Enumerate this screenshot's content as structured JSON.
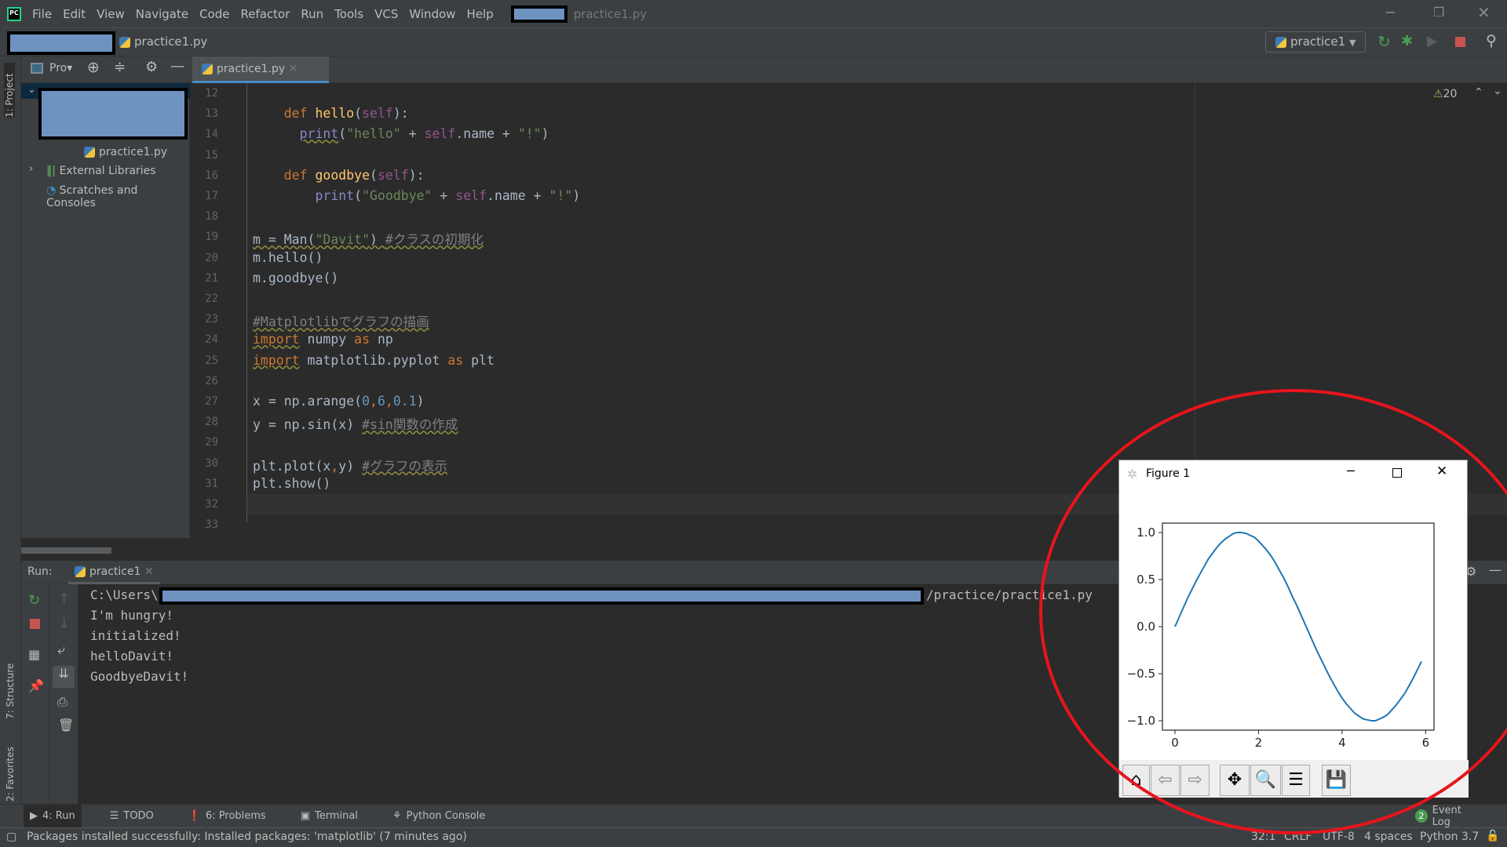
{
  "menubar": {
    "items": [
      "File",
      "Edit",
      "View",
      "Navigate",
      "Code",
      "Refactor",
      "Run",
      "Tools",
      "VCS",
      "Window",
      "Help"
    ],
    "file_title": "practice1.py"
  },
  "navbar": {
    "file": "practice1.py",
    "run_config": "practice1"
  },
  "project": {
    "panel_label": "Pro▾",
    "stripe_label": "1: Project",
    "items": [
      {
        "label": "practice1.py"
      },
      {
        "label": "External Libraries"
      },
      {
        "label": "Scratches and Consoles"
      }
    ]
  },
  "editor": {
    "tab": "practice1.py",
    "warnings": "20",
    "line_numbers": [
      "12",
      "13",
      "14",
      "15",
      "16",
      "17",
      "18",
      "19",
      "20",
      "21",
      "22",
      "23",
      "24",
      "25",
      "26",
      "27",
      "28",
      "29",
      "30",
      "31",
      "32",
      "33"
    ],
    "lines": [
      [],
      [
        [
          "    ",
          ""
        ],
        [
          "def",
          "kw"
        ],
        [
          " ",
          ""
        ],
        [
          "hello",
          "fn"
        ],
        [
          "(",
          ""
        ],
        [
          "self",
          "sf"
        ],
        [
          "):",
          ""
        ]
      ],
      [
        [
          "      ",
          ""
        ],
        [
          "print",
          "bi wavy"
        ],
        [
          "(",
          ""
        ],
        [
          "\"hello\"",
          "st"
        ],
        [
          " + ",
          ""
        ],
        [
          "self",
          "sf"
        ],
        [
          ".name + ",
          ""
        ],
        [
          "\"!\"",
          "st"
        ],
        [
          ")",
          ""
        ]
      ],
      [],
      [
        [
          "    ",
          ""
        ],
        [
          "def",
          "kw"
        ],
        [
          " ",
          ""
        ],
        [
          "goodbye",
          "fn"
        ],
        [
          "(",
          ""
        ],
        [
          "self",
          "sf"
        ],
        [
          "):",
          ""
        ]
      ],
      [
        [
          "        ",
          ""
        ],
        [
          "print",
          "bi"
        ],
        [
          "(",
          ""
        ],
        [
          "\"Goodbye\"",
          "st"
        ],
        [
          " + ",
          ""
        ],
        [
          "self",
          "sf"
        ],
        [
          ".name + ",
          ""
        ],
        [
          "\"!\"",
          "st"
        ],
        [
          ")",
          ""
        ]
      ],
      [],
      [
        [
          "m = Man(",
          "wavy"
        ],
        [
          "\"Davit\"",
          "st wavy"
        ],
        [
          ") ",
          "wavy"
        ],
        [
          "#クラスの初期化",
          "cm wavy"
        ]
      ],
      [
        [
          "m.hello()",
          ""
        ]
      ],
      [
        [
          "m.goodbye()",
          ""
        ]
      ],
      [],
      [
        [
          "#Matplotlibでグラフの描画",
          "cm wavy"
        ]
      ],
      [
        [
          "import",
          "kw wavy"
        ],
        [
          " numpy ",
          ""
        ],
        [
          "as",
          "kw"
        ],
        [
          " np",
          ""
        ]
      ],
      [
        [
          "import",
          "kw wavy"
        ],
        [
          " matplotlib.pyplot ",
          ""
        ],
        [
          "as",
          "kw"
        ],
        [
          " plt",
          ""
        ]
      ],
      [],
      [
        [
          "x = np.arange(",
          ""
        ],
        [
          "0",
          "nu"
        ],
        [
          ",",
          "kw"
        ],
        [
          "6",
          "nu"
        ],
        [
          ",",
          "kw"
        ],
        [
          "0.1",
          "nu"
        ],
        [
          ")",
          ""
        ]
      ],
      [
        [
          "y = np.sin(x) ",
          ""
        ],
        [
          "#sin関数の作成",
          "cm wavy"
        ]
      ],
      [],
      [
        [
          "plt.plot(x",
          ""
        ],
        [
          ",",
          "kw"
        ],
        [
          "y) ",
          ""
        ],
        [
          "#グラフの表示",
          "cm wavy"
        ]
      ],
      [
        [
          "plt.show()",
          ""
        ]
      ],
      [],
      []
    ]
  },
  "run": {
    "label": "Run:",
    "tab": "practice1",
    "output": [
      "C:\\Users\\",
      "I'm hungry!",
      "initialized!",
      "helloDavit!",
      "GoodbyeDavit!"
    ],
    "path_suffix": "/practice/practice1.py"
  },
  "left_stripe": {
    "structure": "7: Structure",
    "favorites": "2: Favorites"
  },
  "bottom_tabs": [
    "4: Run",
    "TODO",
    "6: Problems",
    "Terminal",
    "Python Console"
  ],
  "event_log": {
    "count": "2",
    "label": "Event Log"
  },
  "status": {
    "message": "Packages installed successfully: Installed packages: 'matplotlib' (7 minutes ago)",
    "position": "32:1",
    "line_sep": "CRLF",
    "encoding": "UTF-8",
    "indent": "4 spaces",
    "interpreter": "Python 3.7"
  },
  "figure": {
    "title": "Figure 1"
  },
  "colors": {
    "line": "#1f77b4",
    "annotation": "#e8141c",
    "accent_green": "#499c54",
    "stop_red": "#c75450"
  },
  "chart_data": {
    "type": "line",
    "xlim": [
      -0.3,
      6.2
    ],
    "ylim": [
      -1.1,
      1.1
    ],
    "xticks": [
      "0",
      "2",
      "4",
      "6"
    ],
    "yticks": [
      "1.0",
      "0.5",
      "0.0",
      "−0.5",
      "−1.0"
    ],
    "x": [
      0,
      0.1,
      0.2,
      0.3,
      0.4,
      0.5,
      0.6,
      0.7,
      0.8,
      0.9,
      1.0,
      1.1,
      1.2,
      1.3,
      1.4,
      1.5,
      1.6,
      1.7,
      1.8,
      1.9,
      2.0,
      2.1,
      2.2,
      2.3,
      2.4,
      2.5,
      2.6,
      2.7,
      2.8,
      2.9,
      3.0,
      3.1,
      3.2,
      3.3,
      3.4,
      3.5,
      3.6,
      3.7,
      3.8,
      3.9,
      4.0,
      4.1,
      4.2,
      4.3,
      4.4,
      4.5,
      4.6,
      4.7,
      4.8,
      4.9,
      5.0,
      5.1,
      5.2,
      5.3,
      5.4,
      5.5,
      5.6,
      5.7,
      5.8,
      5.9
    ],
    "y": [
      0.0,
      0.1,
      0.2,
      0.3,
      0.39,
      0.48,
      0.56,
      0.64,
      0.72,
      0.78,
      0.84,
      0.89,
      0.93,
      0.96,
      0.99,
      1.0,
      1.0,
      0.99,
      0.97,
      0.95,
      0.91,
      0.86,
      0.81,
      0.75,
      0.68,
      0.6,
      0.52,
      0.43,
      0.33,
      0.24,
      0.14,
      0.04,
      -0.06,
      -0.16,
      -0.26,
      -0.35,
      -0.44,
      -0.53,
      -0.61,
      -0.69,
      -0.76,
      -0.82,
      -0.87,
      -0.92,
      -0.95,
      -0.98,
      -0.99,
      -1.0,
      -1.0,
      -0.98,
      -0.96,
      -0.93,
      -0.88,
      -0.83,
      -0.77,
      -0.71,
      -0.63,
      -0.55,
      -0.46,
      -0.37
    ]
  }
}
